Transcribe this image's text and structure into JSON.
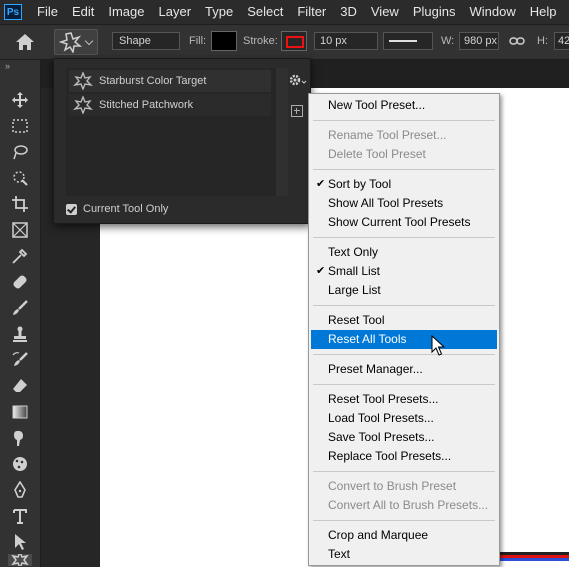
{
  "menubar": {
    "logo": "Ps",
    "items": [
      "File",
      "Edit",
      "Image",
      "Layer",
      "Type",
      "Select",
      "Filter",
      "3D",
      "View",
      "Plugins",
      "Window",
      "Help"
    ]
  },
  "options": {
    "shape_mode": "Shape",
    "fill_label": "Fill:",
    "stroke_label": "Stroke:",
    "stroke_width": "10 px",
    "w_label": "W:",
    "w_value": "980 px",
    "h_label": "H:",
    "h_value": "42",
    "fill_color": "#000000",
    "stroke_color": "#ee1111"
  },
  "toolbar": {
    "collapse": "»",
    "tools": [
      "move-icon",
      "marquee-icon",
      "lasso-icon",
      "quick-select-icon",
      "crop-icon",
      "frame-icon",
      "eyedropper-icon",
      "healing-icon",
      "brush-icon",
      "stamp-icon",
      "history-brush-icon",
      "eraser-icon",
      "gradient-icon",
      "smudge-icon",
      "sponge-icon",
      "pen-icon",
      "type-icon",
      "path-select-icon",
      "custom-shape-icon"
    ]
  },
  "preset_panel": {
    "presets": [
      "Starburst Color Target",
      "Stitched Patchwork"
    ],
    "current_only_label": "Current Tool Only",
    "current_only_checked": true
  },
  "context_menu": {
    "items": [
      {
        "label": "New Tool Preset...",
        "enabled": true,
        "checked": false
      },
      {
        "label": "Rename Tool Preset...",
        "enabled": false,
        "checked": false
      },
      {
        "label": "Delete Tool Preset",
        "enabled": false,
        "checked": false
      },
      {
        "label": "Sort by Tool",
        "enabled": true,
        "checked": true
      },
      {
        "label": "Show All Tool Presets",
        "enabled": true,
        "checked": false
      },
      {
        "label": "Show Current Tool Presets",
        "enabled": true,
        "checked": false
      },
      {
        "label": "Text Only",
        "enabled": true,
        "checked": false
      },
      {
        "label": "Small List",
        "enabled": true,
        "checked": true
      },
      {
        "label": "Large List",
        "enabled": true,
        "checked": false
      },
      {
        "label": "Reset Tool",
        "enabled": true,
        "checked": false
      },
      {
        "label": "Reset All Tools",
        "enabled": true,
        "checked": false,
        "highlighted": true
      },
      {
        "label": "Preset Manager...",
        "enabled": true,
        "checked": false
      },
      {
        "label": "Reset Tool Presets...",
        "enabled": true,
        "checked": false
      },
      {
        "label": "Load Tool Presets...",
        "enabled": true,
        "checked": false
      },
      {
        "label": "Save Tool Presets...",
        "enabled": true,
        "checked": false
      },
      {
        "label": "Replace Tool Presets...",
        "enabled": true,
        "checked": false
      },
      {
        "label": "Convert to Brush Preset",
        "enabled": false,
        "checked": false
      },
      {
        "label": "Convert All to Brush Presets...",
        "enabled": false,
        "checked": false
      },
      {
        "label": "Crop and Marquee",
        "enabled": true,
        "checked": false
      },
      {
        "label": "Text",
        "enabled": true,
        "checked": false
      }
    ],
    "check_glyph": "✔",
    "highlight_color": "#0078d7"
  }
}
